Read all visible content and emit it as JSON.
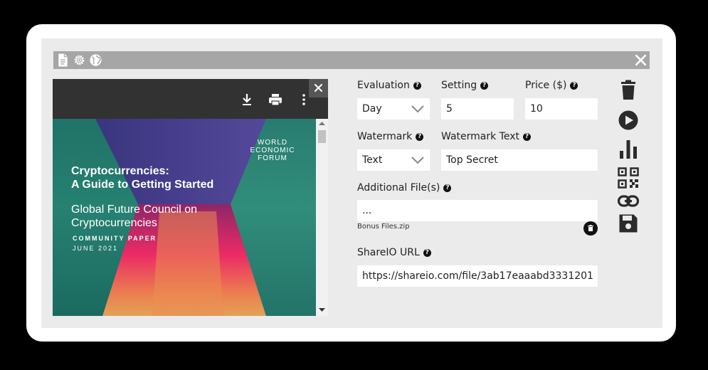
{
  "colors": {
    "background": "#000000",
    "card": "#ffffff",
    "panel": "#ebebeb",
    "titlebar": "#a6a6a6",
    "icon": "#2b2b2b"
  },
  "titlebar": {
    "icons": [
      "document-icon",
      "gear-icon",
      "globe-icon"
    ],
    "close_icon": "close-icon"
  },
  "viewer": {
    "toolbar_icons": [
      "download-icon",
      "print-icon",
      "more-vert-icon"
    ],
    "close_icon": "close-icon",
    "cover": {
      "publisher_line1": "WORLD",
      "publisher_line2": "ECONOMIC",
      "publisher_line3": "FORUM",
      "title_line1": "Cryptocurrencies:",
      "title_line2": "A Guide to Getting Started",
      "subtitle_line1": "Global Future Council on",
      "subtitle_line2": "Cryptocurrencies",
      "paper_type": "COMMUNITY PAPER",
      "date": "JUNE 2021"
    }
  },
  "form": {
    "evaluation": {
      "label": "Evaluation",
      "value": "Day"
    },
    "setting": {
      "label": "Setting",
      "value": "5"
    },
    "price": {
      "label": "Price ($)",
      "value": "10"
    },
    "watermark": {
      "label": "Watermark",
      "value": "Text"
    },
    "watermark_text": {
      "label": "Watermark Text",
      "value": "Top Secret"
    },
    "additional_files": {
      "label": "Additional File(s)",
      "value": "...",
      "file_name": "Bonus Files.zip"
    },
    "shareio_url": {
      "label": "ShareIO URL",
      "value": "https://shareio.com/file/3ab17eaaabd3331201"
    },
    "help_glyph": "?"
  },
  "side_toolbar": [
    "trash-icon",
    "play-icon",
    "bar-chart-icon",
    "qr-code-icon",
    "link-icon",
    "save-icon"
  ]
}
